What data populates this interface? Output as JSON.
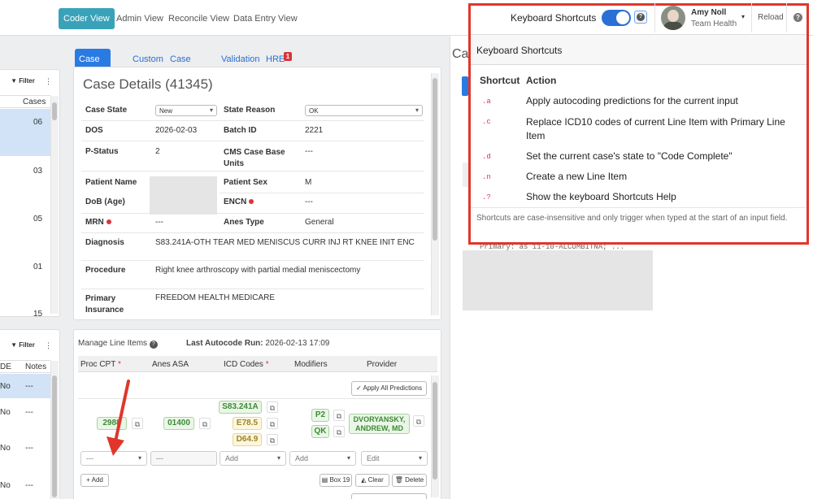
{
  "nav": {
    "tabs": [
      "Coder View",
      "Admin View",
      "Reconcile View",
      "Data Entry View"
    ]
  },
  "user": {
    "name": "Amy Noll",
    "team": "Team Health",
    "reload": "Reload"
  },
  "header": {
    "kb_toggle_label": "Keyboard Shortcuts",
    "help_glyph": "?"
  },
  "left": {
    "filter": "Filter",
    "cases_col": "Cases",
    "rows": [
      "06",
      "03",
      "05",
      "01",
      "15"
    ],
    "cols": {
      "de": "DE",
      "notes": "Notes"
    },
    "lower_rows": [
      {
        "de": "No",
        "notes": "---"
      },
      {
        "de": "No",
        "notes": "---"
      },
      {
        "de": "No",
        "notes": "---"
      },
      {
        "de": "No",
        "notes": "---"
      }
    ]
  },
  "case_tabs": [
    "Case Details",
    "Custom",
    "Case Notes",
    "Validation",
    "HRE"
  ],
  "hre_badge": "1",
  "case": {
    "title": "Case Details (41345)",
    "case_state_label": "Case State",
    "case_state": "New",
    "state_reason_label": "State Reason",
    "state_reason": "OK",
    "dos_label": "DOS",
    "dos": "2026-02-03",
    "batch_label": "Batch ID",
    "batch": "2221",
    "pstatus_label": "P-Status",
    "pstatus": "2",
    "cms_label": "CMS Case Base Units",
    "cms": "---",
    "patient_name_label": "Patient Name",
    "sex_label": "Patient Sex",
    "sex": "M",
    "dob_label": "DoB (Age)",
    "encn_label": "ENCN",
    "encn": "---",
    "mrn_label": "MRN",
    "mrn": "---",
    "anes_label": "Anes Type",
    "anes": "General",
    "diag_label": "Diagnosis",
    "diag": "S83.241A-OTH TEAR MED MENISCUS CURR INJ RT KNEE INIT ENC",
    "proc_label": "Procedure",
    "proc": "Right knee arthroscopy with partial medial meniscectomy",
    "ins_label": "Primary Insurance",
    "ins": "FREEDOM HEALTH MEDICARE"
  },
  "line_items": {
    "manage": "Manage Line Items",
    "last_run_label": "Last Autocode Run:",
    "last_run": "2026-02-13 17:09",
    "cols": [
      "Proc CPT",
      "Anes ASA",
      "ICD Codes",
      "Modifiers",
      "Provider"
    ],
    "apply_all": "Apply All Predictions",
    "cpt": "2988",
    "asa": "01400",
    "icd": [
      "S83.241A",
      "E78.5",
      "D64.9"
    ],
    "mods": [
      "P2",
      "QK"
    ],
    "provider": "DVORYANSKY, ANDREW, MD",
    "placeholder_cpt": "---",
    "placeholder_asa": "---",
    "add1": "Add",
    "add2": "Add",
    "edit": "Edit",
    "add_btn": "Add",
    "box19": "Box 19",
    "clear": "Clear",
    "delete": "Delete"
  },
  "right_title": "Ca",
  "right_code": "Primary: as 11-10-ALCUMBITNA; ...",
  "popup": {
    "title": "Keyboard Shortcuts",
    "col_shortcut": "Shortcut",
    "col_action": "Action",
    "items": [
      {
        "key": ".a",
        "action": "Apply autocoding predictions for the current input"
      },
      {
        "key": ".c",
        "action": "Replace ICD10 codes of current Line Item with Primary Line Item"
      },
      {
        "key": ".d",
        "action": "Set the current case's state to \"Code Complete\""
      },
      {
        "key": ".n",
        "action": "Create a new Line Item"
      },
      {
        "key": ".?",
        "action": "Show the keyboard Shortcuts Help"
      }
    ],
    "footer": "Shortcuts are case-insensitive and only trigger when typed at the start of an input field."
  },
  "colors": {
    "accent": "#3aa2b8",
    "link": "#2a7ae4",
    "highlight": "#e0362b",
    "toggle": "#2a6fd6"
  }
}
